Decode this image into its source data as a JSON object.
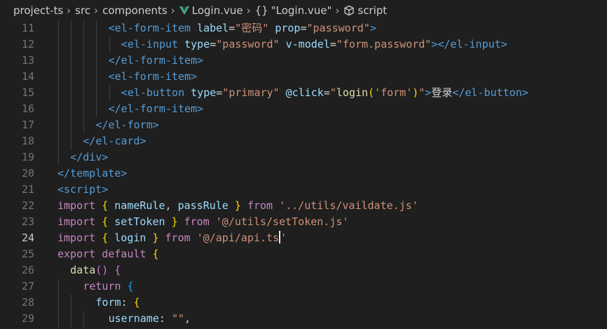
{
  "breadcrumb": {
    "items": [
      "project-ts",
      "src",
      "components",
      "Login.vue",
      "\"Login.vue\"",
      "script"
    ],
    "braces_symbol": "{}"
  },
  "editor": {
    "active_line": 24,
    "lines": [
      {
        "num": "11",
        "tokens": [
          [
            "tag",
            "<el-form-item "
          ],
          [
            "attr",
            "label"
          ],
          [
            "plain",
            "="
          ],
          [
            "str",
            "\"密码\""
          ],
          [
            "plain",
            " "
          ],
          [
            "attr",
            "prop"
          ],
          [
            "plain",
            "="
          ],
          [
            "str",
            "\"password\""
          ],
          [
            "tag",
            ">"
          ]
        ]
      },
      {
        "num": "12",
        "tokens": [
          [
            "tag",
            "<el-input "
          ],
          [
            "attr",
            "type"
          ],
          [
            "plain",
            "="
          ],
          [
            "str",
            "\"password\""
          ],
          [
            "plain",
            " "
          ],
          [
            "attr",
            "v-model"
          ],
          [
            "plain",
            "="
          ],
          [
            "str",
            "\"form.password\""
          ],
          [
            "tag",
            "></el-input>"
          ]
        ]
      },
      {
        "num": "13",
        "tokens": [
          [
            "tag",
            "</el-form-item>"
          ]
        ]
      },
      {
        "num": "14",
        "tokens": [
          [
            "tag",
            "<el-form-item>"
          ]
        ]
      },
      {
        "num": "15",
        "tokens": [
          [
            "tag",
            "<el-button "
          ],
          [
            "attr",
            "type"
          ],
          [
            "plain",
            "="
          ],
          [
            "str",
            "\"primary\""
          ],
          [
            "plain",
            " "
          ],
          [
            "attr",
            "@click"
          ],
          [
            "plain",
            "="
          ],
          [
            "str",
            "\""
          ],
          [
            "fn",
            "login"
          ],
          [
            "brace",
            "("
          ],
          [
            "str",
            "'form'"
          ],
          [
            "brace",
            ")"
          ],
          [
            "str",
            "\""
          ],
          [
            "tag",
            ">"
          ],
          [
            "plain",
            "登录"
          ],
          [
            "tag",
            "</el-button>"
          ]
        ]
      },
      {
        "num": "16",
        "tokens": [
          [
            "tag",
            "</el-form-item>"
          ]
        ]
      },
      {
        "num": "17",
        "tokens": [
          [
            "tag",
            "</el-form>"
          ]
        ]
      },
      {
        "num": "18",
        "tokens": [
          [
            "tag",
            "</el-card>"
          ]
        ]
      },
      {
        "num": "19",
        "tokens": [
          [
            "tag",
            "</div>"
          ]
        ]
      },
      {
        "num": "20",
        "tokens": [
          [
            "tag",
            "</template>"
          ]
        ]
      },
      {
        "num": "21",
        "tokens": [
          [
            "tag",
            "<script>"
          ]
        ]
      },
      {
        "num": "22",
        "tokens": [
          [
            "kw",
            "import"
          ],
          [
            "plain",
            " "
          ],
          [
            "brace",
            "{"
          ],
          [
            "plain",
            " "
          ],
          [
            "var",
            "nameRule"
          ],
          [
            "plain",
            ", "
          ],
          [
            "var",
            "passRule"
          ],
          [
            "plain",
            " "
          ],
          [
            "brace",
            "}"
          ],
          [
            "plain",
            " "
          ],
          [
            "kw",
            "from"
          ],
          [
            "plain",
            " "
          ],
          [
            "str",
            "'../utils/vaildate.js'"
          ]
        ]
      },
      {
        "num": "23",
        "tokens": [
          [
            "kw",
            "import"
          ],
          [
            "plain",
            " "
          ],
          [
            "brace",
            "{"
          ],
          [
            "plain",
            " "
          ],
          [
            "var",
            "setToken"
          ],
          [
            "plain",
            " "
          ],
          [
            "brace",
            "}"
          ],
          [
            "plain",
            " "
          ],
          [
            "kw",
            "from"
          ],
          [
            "plain",
            " "
          ],
          [
            "str",
            "'@/utils/setToken.js'"
          ]
        ]
      },
      {
        "num": "24",
        "tokens": [
          [
            "kw",
            "import"
          ],
          [
            "plain",
            " "
          ],
          [
            "brace",
            "{"
          ],
          [
            "plain",
            " "
          ],
          [
            "var",
            "login"
          ],
          [
            "plain",
            " "
          ],
          [
            "brace",
            "}"
          ],
          [
            "plain",
            " "
          ],
          [
            "kw",
            "from"
          ],
          [
            "plain",
            " "
          ],
          [
            "str",
            "'@/api/api.ts"
          ],
          [
            "cursor",
            ""
          ],
          [
            "str",
            "'"
          ]
        ]
      },
      {
        "num": "25",
        "tokens": [
          [
            "kw",
            "export"
          ],
          [
            "plain",
            " "
          ],
          [
            "kw",
            "default"
          ],
          [
            "plain",
            " "
          ],
          [
            "brace",
            "{"
          ]
        ]
      },
      {
        "num": "26",
        "tokens": [
          [
            "fn",
            "data"
          ],
          [
            "brace2",
            "()"
          ],
          [
            "plain",
            " "
          ],
          [
            "brace2",
            "{"
          ]
        ]
      },
      {
        "num": "27",
        "tokens": [
          [
            "kw",
            "return"
          ],
          [
            "plain",
            " "
          ],
          [
            "brace3",
            "{"
          ]
        ]
      },
      {
        "num": "28",
        "tokens": [
          [
            "var",
            "form"
          ],
          [
            "plain",
            ": "
          ],
          [
            "brace",
            "{"
          ]
        ]
      },
      {
        "num": "29",
        "tokens": [
          [
            "var",
            "username"
          ],
          [
            "plain",
            ": "
          ],
          [
            "str",
            "\"\""
          ],
          [
            "plain",
            ","
          ]
        ]
      }
    ]
  }
}
